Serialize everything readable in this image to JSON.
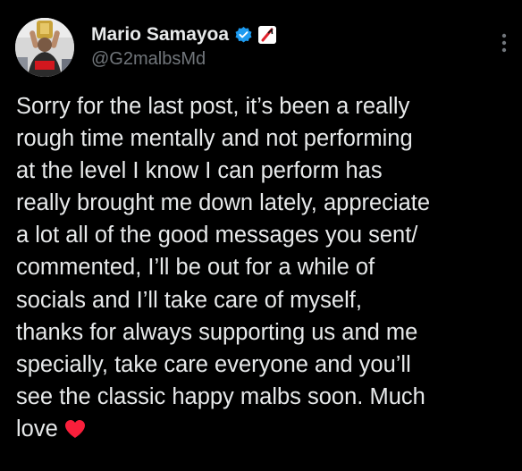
{
  "tweet": {
    "author": {
      "display_name": "Mario Samayoa",
      "handle": "@G2malbsMd",
      "avatar_icon": "user-avatar-trophy",
      "verified_icon": "verified-badge-icon",
      "affiliate_icon": "affiliate-badge-icon"
    },
    "more_icon": "more-options-icon",
    "text": "Sorry for the last post, it’s been a really\nrough time mentally and not performing\nat the level I know I can perform has\nreally brought me down lately, appreciate\na lot all of the good messages you sent/\ncommented, I’ll be out for a while of\nsocials and I’ll take care of myself,\nthanks for always supporting us and me\nspecially, take care everyone and you’ll\nsee the classic happy malbs soon. Much\nlove",
    "emoji": "red-heart"
  },
  "colors": {
    "background": "#000000",
    "text_primary": "#e7e9ea",
    "text_secondary": "#71767b",
    "verified_blue": "#1d9bf0",
    "heart_red": "#f91f3b"
  }
}
